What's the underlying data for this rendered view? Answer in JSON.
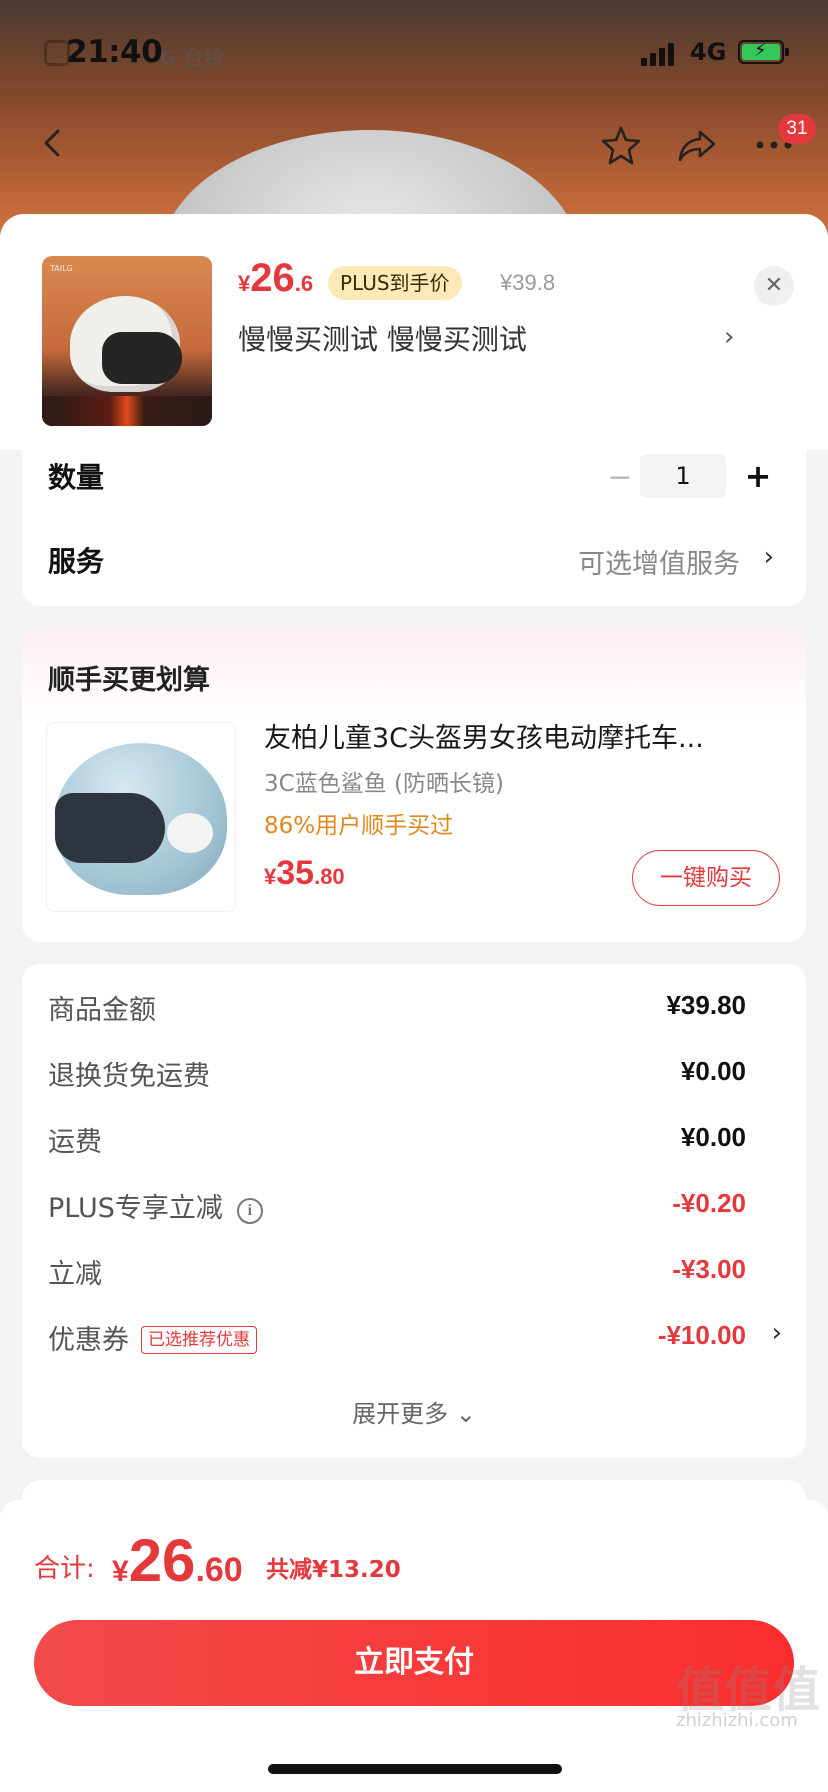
{
  "status_bar": {
    "time": "21:40",
    "carrier_brand": "G 台铃",
    "network": "4G"
  },
  "nav": {
    "notification_count": "31"
  },
  "product": {
    "price_currency": "¥",
    "price_int": "26",
    "price_dec": ".6",
    "plus_tag": "PLUS到手价",
    "original_price": "¥39.8",
    "variant": "慢慢买测试  慢慢买测试",
    "variant_arrow": "›",
    "close": "✕",
    "thumb_brand": "TAILG"
  },
  "quantity": {
    "label": "数量",
    "minus": "−",
    "value": "1",
    "plus": "+"
  },
  "service": {
    "label": "服务",
    "value": "可选增值服务",
    "arrow": "›"
  },
  "combo": {
    "title": "顺手买更划算",
    "name": "友柏儿童3C头盔男女孩电动摩托车...",
    "spec": "3C蓝色鲨鱼 (防晒长镜)",
    "percent": "86%用户顺手买过",
    "price_currency": "¥",
    "price_int": "35",
    "price_dec": ".80",
    "buy_label": "一键购买"
  },
  "fees": {
    "rows": [
      {
        "label": "商品金额",
        "value": "¥39.80",
        "highlight": false
      },
      {
        "label": "退换货免运费",
        "value": "¥0.00",
        "highlight": false
      },
      {
        "label": "运费",
        "value": "¥0.00",
        "highlight": false
      },
      {
        "label": "PLUS专享立减",
        "value": "-¥0.20",
        "highlight": true,
        "info_icon": "i"
      },
      {
        "label": "立减",
        "value": "-¥3.00",
        "highlight": true
      },
      {
        "label": "优惠券",
        "value": "-¥10.00",
        "highlight": true,
        "tag": "已选推荐优惠",
        "arrow": "›"
      }
    ],
    "expand_label": "展开更多 ⌄"
  },
  "footer": {
    "total_label": "合计:",
    "total_currency": "¥",
    "total_int": "26",
    "total_dec": ".60",
    "total_save": "共减¥13.20",
    "pay_label": "立即支付"
  },
  "watermark": {
    "big": "值值值",
    "small": "zhizhizhi.com"
  },
  "colors": {
    "accent_red": "#e4393c",
    "plus_gold": "#fbe9b8",
    "orange_text": "#e0881e"
  },
  "icons": [
    "back-icon",
    "star-icon",
    "share-icon",
    "more-icon",
    "close-icon",
    "info-icon",
    "chevron-right-icon"
  ]
}
